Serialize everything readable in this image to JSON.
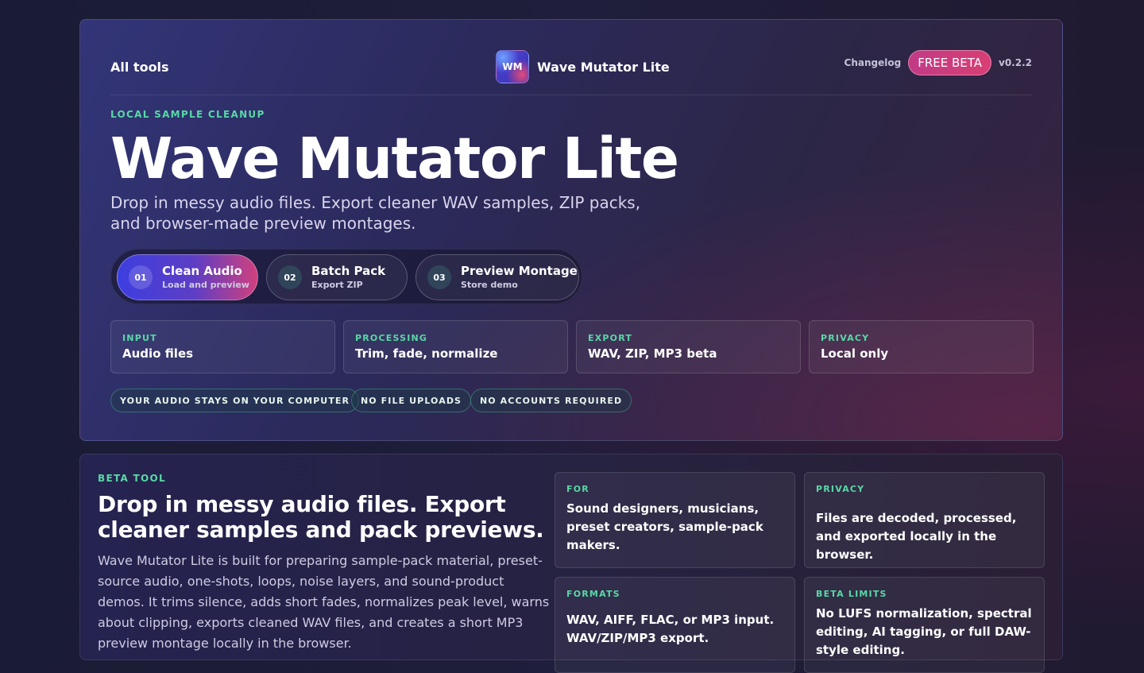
{
  "topbar": {
    "all_tools": "All tools",
    "logo_text": "WM",
    "brand_name": "Wave Mutator Lite",
    "changelog": "Changelog",
    "badge": "FREE BETA",
    "version": "v0.2.2"
  },
  "hero": {
    "eyebrow": "LOCAL SAMPLE CLEANUP",
    "title": "Wave Mutator Lite",
    "lead": "Drop in messy audio files. Export cleaner WAV samples, ZIP packs, and browser-made preview montages.",
    "steps": [
      {
        "num": "01",
        "title": "Clean Audio",
        "sub": "Load and preview",
        "active": true
      },
      {
        "num": "02",
        "title": "Batch Pack",
        "sub": "Export ZIP",
        "active": false
      },
      {
        "num": "03",
        "title": "Preview Montage",
        "sub": "Store demo",
        "active": false
      }
    ],
    "stats": [
      {
        "label": "INPUT",
        "value": "Audio files"
      },
      {
        "label": "PROCESSING",
        "value": "Trim, fade, normalize"
      },
      {
        "label": "EXPORT",
        "value": "WAV, ZIP, MP3 beta"
      },
      {
        "label": "PRIVACY",
        "value": "Local only"
      }
    ],
    "pills": [
      "YOUR AUDIO STAYS ON YOUR COMPUTER",
      "NO FILE UPLOADS",
      "NO ACCOUNTS REQUIRED"
    ]
  },
  "about": {
    "eyebrow": "BETA TOOL",
    "heading": "Drop in messy audio files. Export cleaner samples and pack previews.",
    "body": "Wave Mutator Lite is built for preparing sample-pack material, preset-source audio, one-shots, loops, noise layers, and sound-product demos. It trims silence, adds short fades, normalizes peak level, warns about clipping, exports cleaned WAV files, and creates a short MP3 preview montage locally in the browser.",
    "cards": [
      {
        "label": "FOR",
        "text": "Sound designers, musicians, preset creators, sample-pack makers."
      },
      {
        "label": "PRIVACY",
        "text": "Files are decoded, processed, and exported locally in the browser."
      },
      {
        "label": "FORMATS",
        "text": "WAV, AIFF, FLAC, or MP3 input. WAV/ZIP/MP3 export."
      },
      {
        "label": "BETA LIMITS",
        "text": "No LUFS normalization, spectral editing, AI tagging, or full DAW-style editing."
      }
    ]
  },
  "colors": {
    "accent_green": "#58d8a6",
    "beta_pink": "#d83f74",
    "active_step_start": "#3d3ee0"
  }
}
